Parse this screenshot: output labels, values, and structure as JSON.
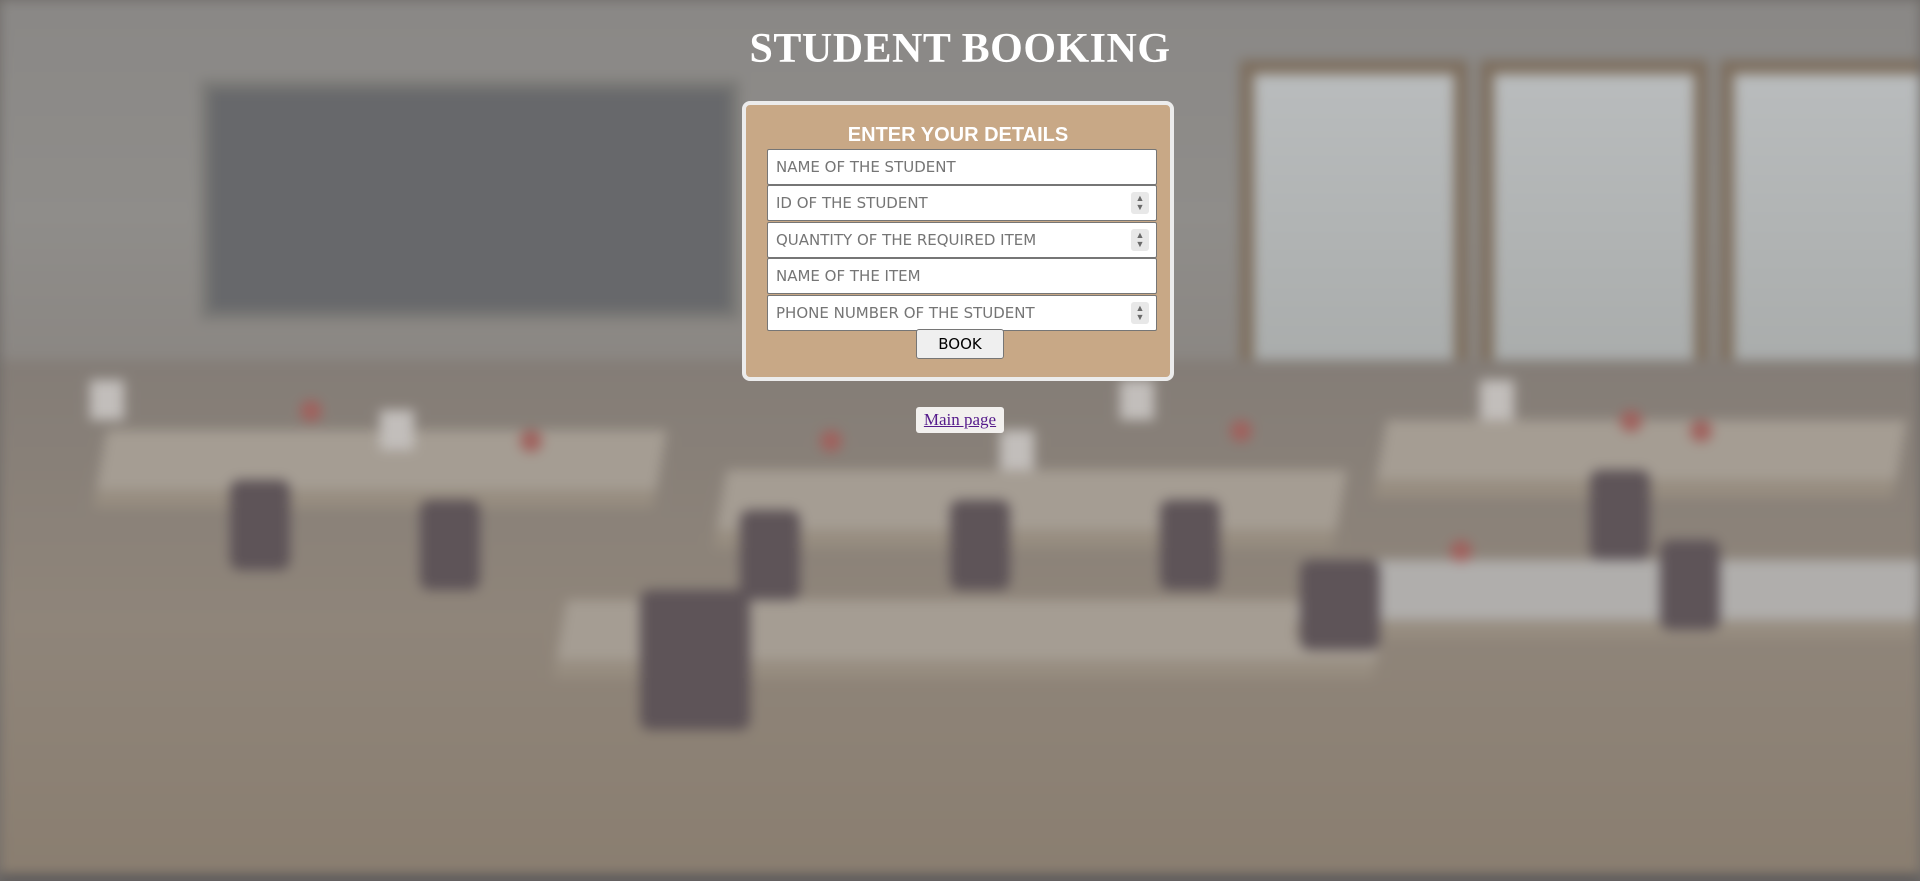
{
  "page": {
    "title": "STUDENT BOOKING"
  },
  "form": {
    "heading": "ENTER YOUR DETAILS",
    "fields": [
      {
        "placeholder": "NAME OF THE STUDENT",
        "value": ""
      },
      {
        "placeholder": "ID OF THE STUDENT",
        "value": ""
      },
      {
        "placeholder": "QUANTITY OF THE REQUIRED ITEM",
        "value": ""
      },
      {
        "placeholder": "NAME OF THE ITEM",
        "value": ""
      },
      {
        "placeholder": "PHONE NUMBER OF THE STUDENT",
        "value": ""
      }
    ],
    "submit_label": "BOOK"
  },
  "nav": {
    "main_page_label": "Main page"
  },
  "colors": {
    "card_background": "#c8a886",
    "card_border": "#ececec",
    "title_text": "#ffffff",
    "link": "#551a8b"
  },
  "icons": {
    "spinner": "spinner-arrows-icon"
  }
}
